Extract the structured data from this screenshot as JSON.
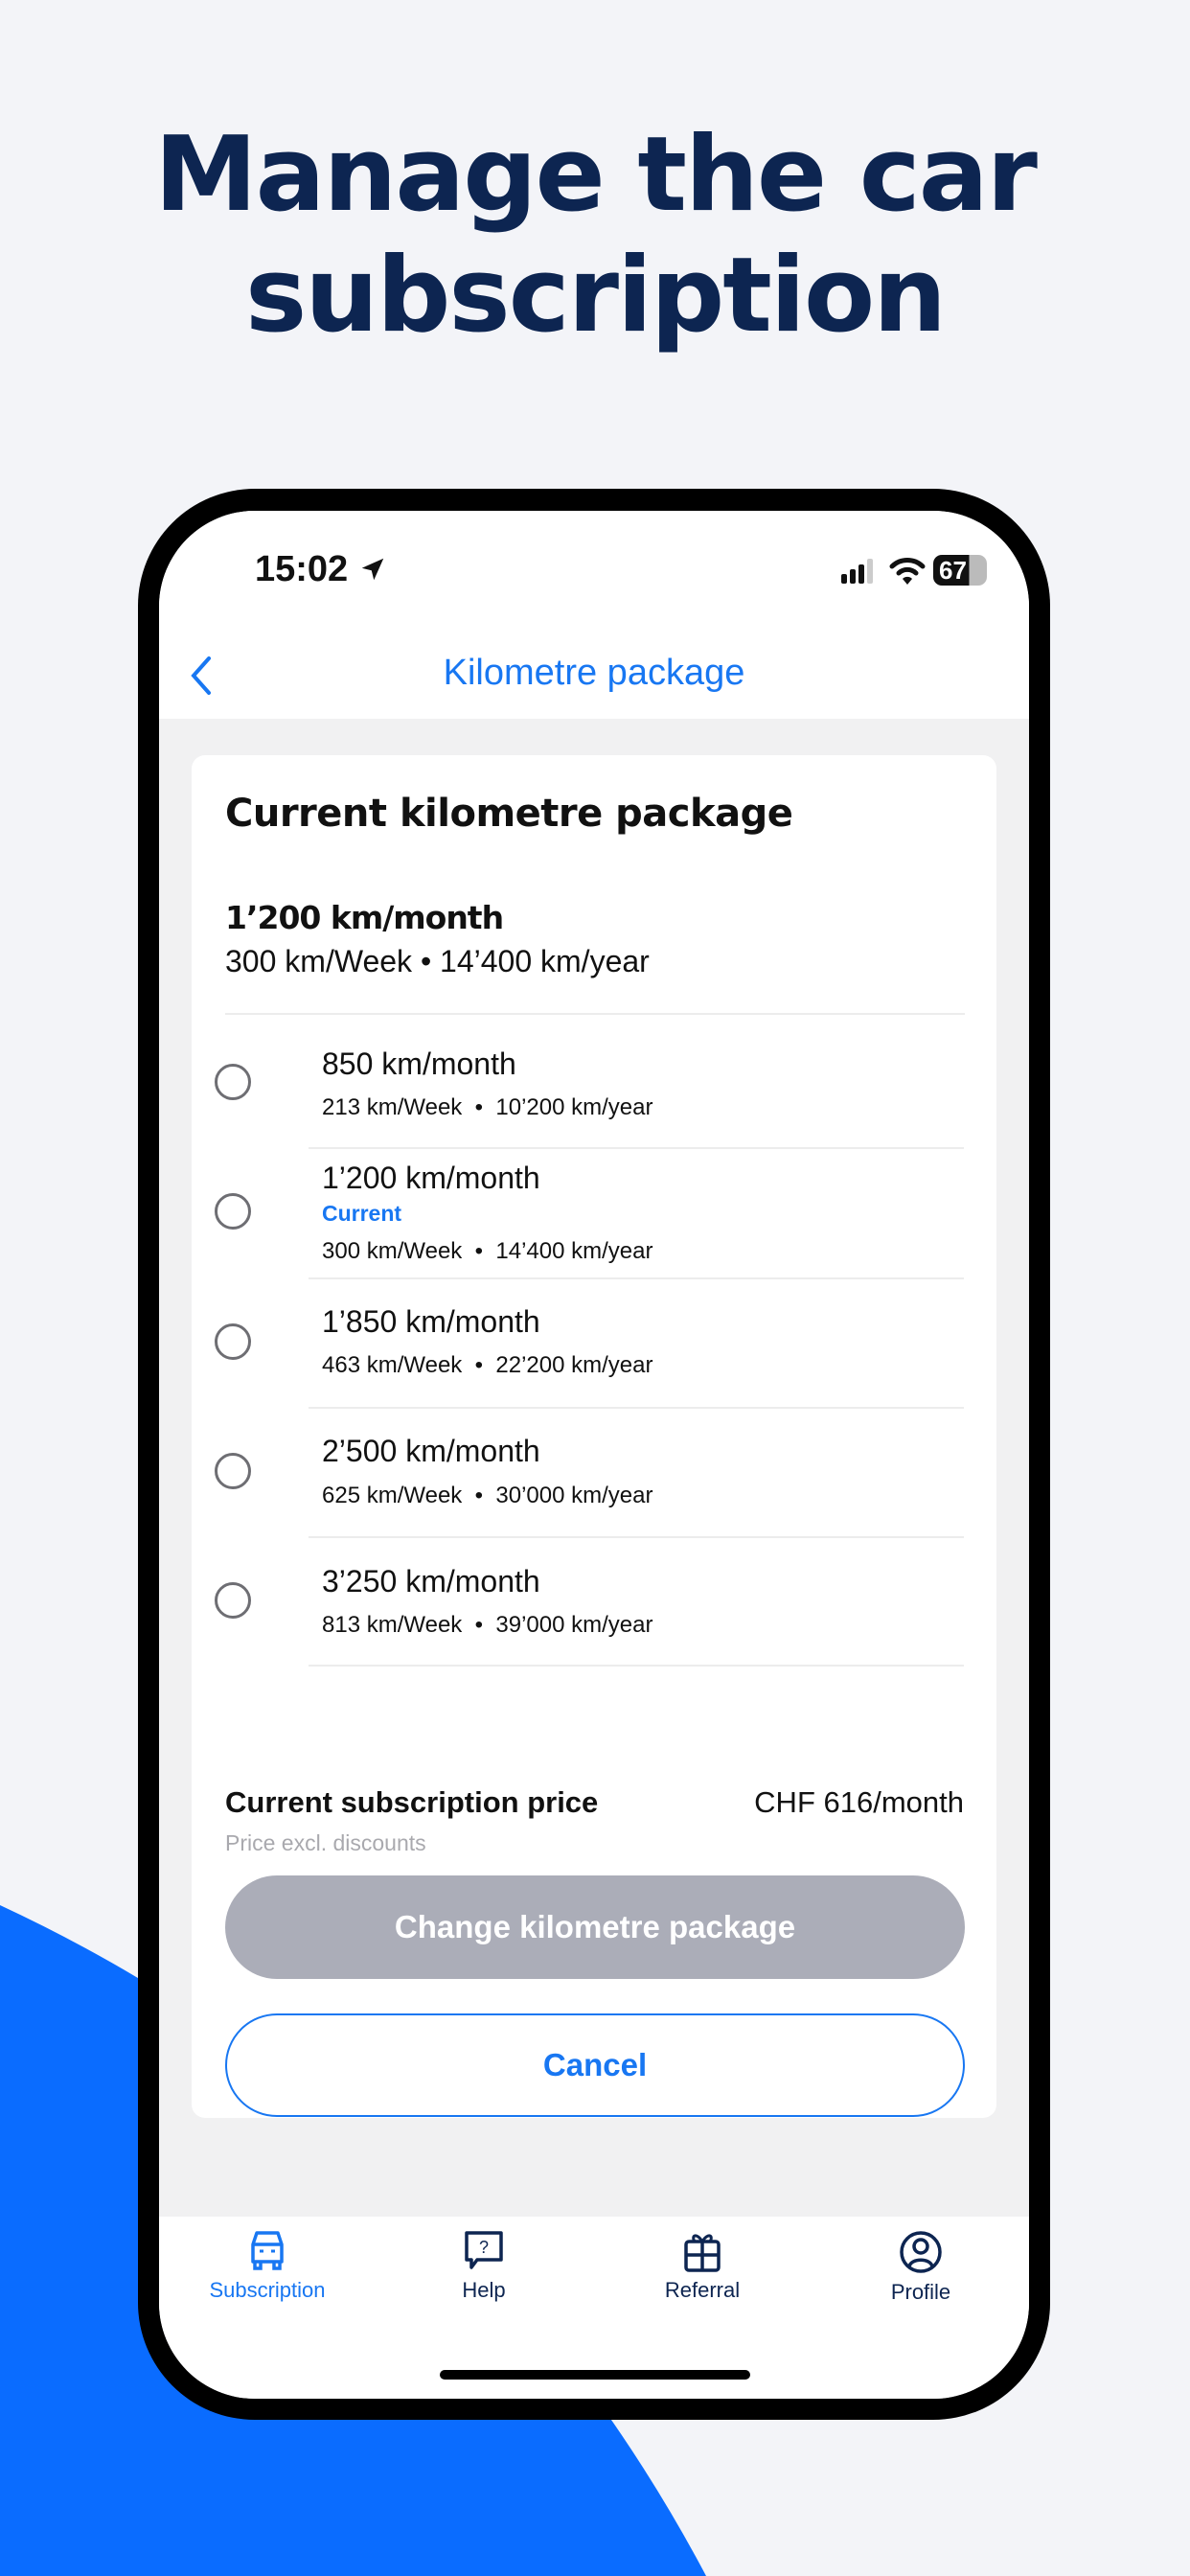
{
  "headline": {
    "line1": "Manage the car",
    "line2": "subscription"
  },
  "status_bar": {
    "time": "15:02",
    "battery": "67"
  },
  "header": {
    "title": "Kilometre package"
  },
  "card": {
    "title": "Current kilometre package",
    "current_package": "1’200 km/month",
    "current_details": "300 km/Week • 14’400 km/year",
    "options": [
      {
        "title": "850 km/month",
        "week": "213 km/Week",
        "year": "10’200 km/year",
        "badge": "",
        "selected": false
      },
      {
        "title": "1’200 km/month",
        "week": "300 km/Week",
        "year": "14’400 km/year",
        "badge": "Current",
        "selected": false
      },
      {
        "title": "1’850 km/month",
        "week": "463 km/Week",
        "year": "22’200 km/year",
        "badge": "",
        "selected": false
      },
      {
        "title": "2’500 km/month",
        "week": "625 km/Week",
        "year": "30’000 km/year",
        "badge": "",
        "selected": false
      },
      {
        "title": "3’250 km/month",
        "week": "813 km/Week",
        "year": "39’000 km/year",
        "badge": "",
        "selected": false
      }
    ],
    "price_label": "Current subscription price",
    "price_value": "CHF 616/month",
    "price_note": "Price excl. discounts",
    "change_button": "Change kilometre package",
    "cancel_button": "Cancel"
  },
  "tabs": [
    {
      "label": "Subscription",
      "icon": "car-icon",
      "active": true
    },
    {
      "label": "Help",
      "icon": "help-bubble-icon",
      "active": false
    },
    {
      "label": "Referral",
      "icon": "gift-icon",
      "active": false
    },
    {
      "label": "Profile",
      "icon": "profile-icon",
      "active": false
    }
  ],
  "colors": {
    "accent": "#1877f2",
    "navy": "#0d2551",
    "disabled_button": "#abadb8",
    "background_blob": "#0a6cff"
  }
}
